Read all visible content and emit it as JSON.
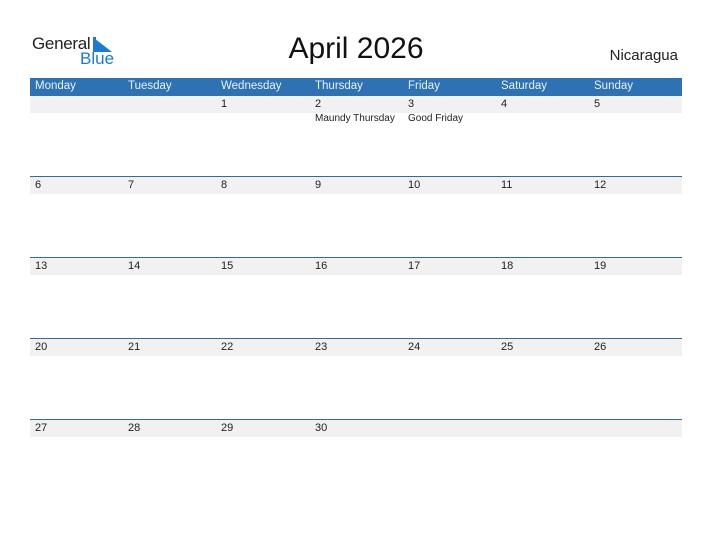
{
  "logo": {
    "general": "General",
    "blue": "Blue",
    "icon": "triangle-flag-icon"
  },
  "title": "April 2026",
  "country": "Nicaragua",
  "colors": {
    "header_bg": "#2e72b3",
    "accent": "#1a7bd0",
    "band": "#f1f1f1",
    "rule": "#2e6ca8"
  },
  "weekdays": [
    "Monday",
    "Tuesday",
    "Wednesday",
    "Thursday",
    "Friday",
    "Saturday",
    "Sunday"
  ],
  "weeks": [
    [
      {
        "day": ""
      },
      {
        "day": ""
      },
      {
        "day": "1"
      },
      {
        "day": "2",
        "event": "Maundy Thursday"
      },
      {
        "day": "3",
        "event": "Good Friday"
      },
      {
        "day": "4"
      },
      {
        "day": "5"
      }
    ],
    [
      {
        "day": "6"
      },
      {
        "day": "7"
      },
      {
        "day": "8"
      },
      {
        "day": "9"
      },
      {
        "day": "10"
      },
      {
        "day": "11"
      },
      {
        "day": "12"
      }
    ],
    [
      {
        "day": "13"
      },
      {
        "day": "14"
      },
      {
        "day": "15"
      },
      {
        "day": "16"
      },
      {
        "day": "17"
      },
      {
        "day": "18"
      },
      {
        "day": "19"
      }
    ],
    [
      {
        "day": "20"
      },
      {
        "day": "21"
      },
      {
        "day": "22"
      },
      {
        "day": "23"
      },
      {
        "day": "24"
      },
      {
        "day": "25"
      },
      {
        "day": "26"
      }
    ],
    [
      {
        "day": "27"
      },
      {
        "day": "28"
      },
      {
        "day": "29"
      },
      {
        "day": "30"
      },
      {
        "day": ""
      },
      {
        "day": ""
      },
      {
        "day": ""
      }
    ]
  ]
}
